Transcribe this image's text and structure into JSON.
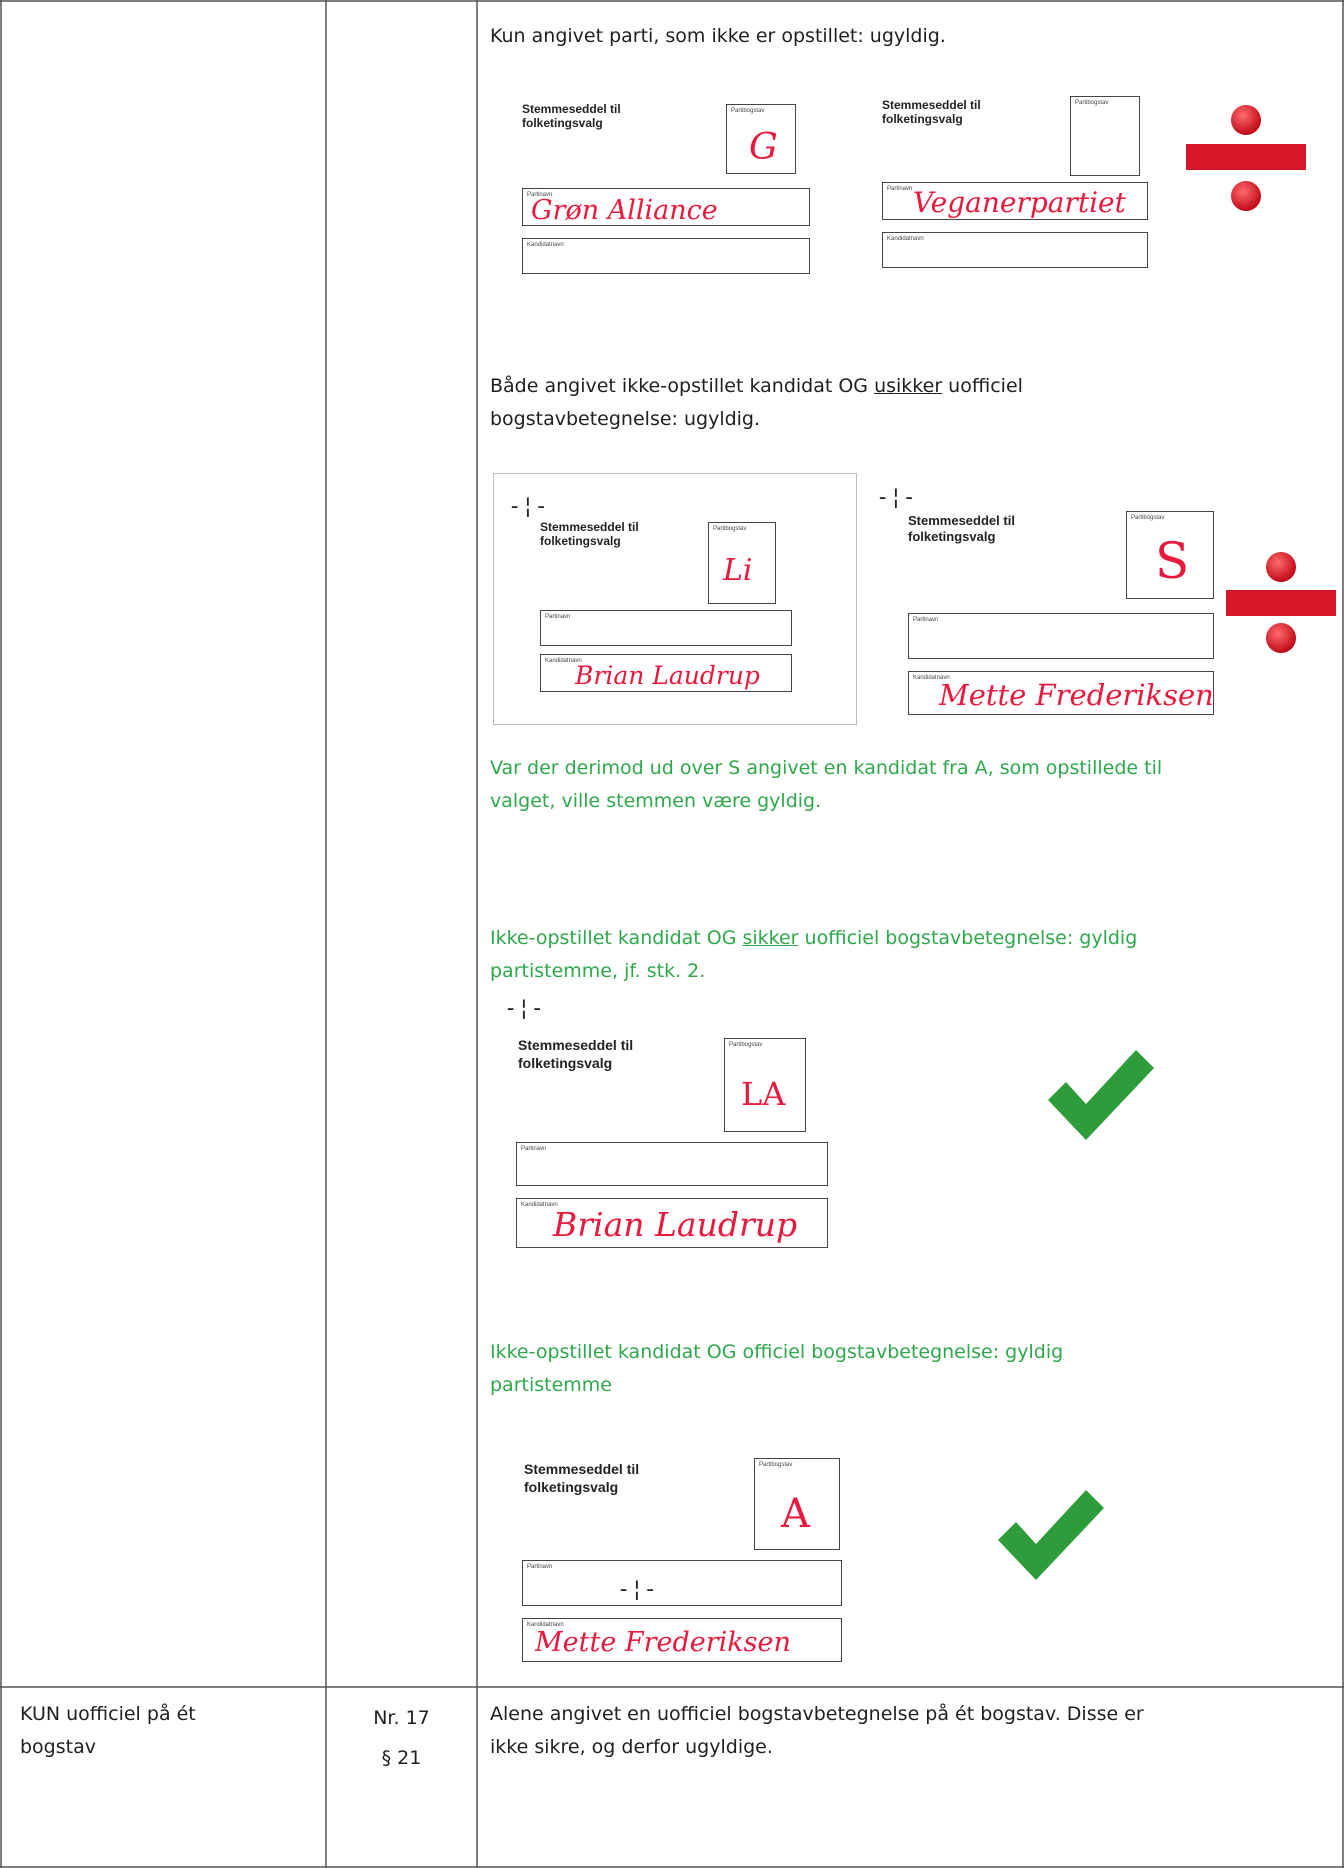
{
  "section1": {
    "heading": "Kun angivet parti, som ikke er opstillet: ugyldig.",
    "ballots": [
      {
        "title_l1": "Stemmeseddel til",
        "title_l2": "folketingsvalg",
        "letter_label": "Partibogstav",
        "letter": "G",
        "party_label": "Partinavn",
        "party": "Grøn Alliance",
        "cand_label": "Kandidatnavn",
        "cand": ""
      },
      {
        "title_l1": "Stemmeseddel til",
        "title_l2": "folketingsvalg",
        "letter_label": "Partibogstav",
        "letter": "",
        "party_label": "Partinavn",
        "party": "Veganerpartiet",
        "cand_label": "Kandidatnavn",
        "cand": ""
      }
    ],
    "mark": "invalid-icon"
  },
  "section2": {
    "heading_a": "Både angivet ikke-opstillet kandidat OG ",
    "heading_u": "usikker",
    "heading_b": " uofficiel",
    "heading_c": "bogstavbetegnelse: ugyldig.",
    "ballots": [
      {
        "title_l1": "Stemmeseddel til",
        "title_l2": "folketingsvalg",
        "letter_label": "Partibogstav",
        "letter": "Li",
        "party_label": "Partinavn",
        "party": "",
        "cand_label": "Kandidatnavn",
        "cand": "Brian Laudrup"
      },
      {
        "title_l1": "Stemmeseddel til",
        "title_l2": "folketingsvalg",
        "letter_label": "Partibogstav",
        "letter": "S",
        "party_label": "Partinavn",
        "party": "",
        "cand_label": "Kandidatnavn",
        "cand": "Mette Frederiksen"
      }
    ],
    "note_l1": "Var der derimod ud over S angivet en kandidat fra A, som opstillede til",
    "note_l2": "valget, ville stemmen være gyldig.",
    "mark": "invalid-icon"
  },
  "section3": {
    "heading_a": "Ikke-opstillet kandidat OG ",
    "heading_u": "sikker",
    "heading_b": " uofficiel bogstavbetegnelse: gyldig",
    "heading_c": "partistemme, jf. stk. 2.",
    "ballot": {
      "title_l1": "Stemmeseddel til",
      "title_l2": "folketingsvalg",
      "letter_label": "Partibogstav",
      "letter": "LA",
      "party_label": "Partinavn",
      "party": "",
      "cand_label": "Kandidatnavn",
      "cand": "Brian Laudrup"
    },
    "mark": "checkmark-icon"
  },
  "section4": {
    "heading_l1": "Ikke-opstillet kandidat OG officiel bogstavbetegnelse: gyldig",
    "heading_l2": "partistemme",
    "ballot": {
      "title_l1": "Stemmeseddel til",
      "title_l2": "folketingsvalg",
      "letter_label": "Partibogstav",
      "letter": "A",
      "party_label": "Partinavn",
      "party": "",
      "cand_label": "Kandidatnavn",
      "cand": "Mette Frederiksen"
    },
    "mark": "checkmark-icon"
  },
  "row2": {
    "col1_l1": "KUN uofficiel på ét",
    "col1_l2": "bogstav",
    "col2_l1": "Nr. 17",
    "col2_l2": "§ 21",
    "col3_l1": "Alene angivet en uofficiel bogstavbetegnelse på ét bogstav. Disse er",
    "col3_l2": "ikke sikre, og derfor ugyldige."
  },
  "colors": {
    "text": "#1f1f1f",
    "green_text": "#2ea84a",
    "handwriting": "#e8193c",
    "invalid_red": "#d6172a",
    "check_green": "#2f9c3c",
    "border": "#555555"
  }
}
